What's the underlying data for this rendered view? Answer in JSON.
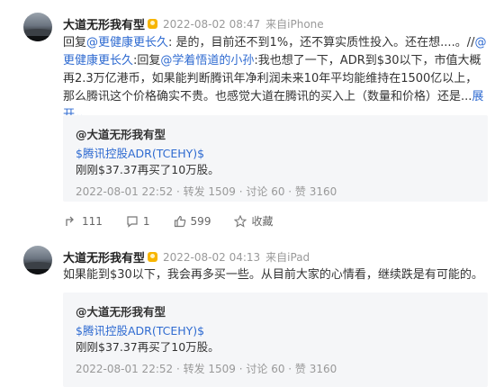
{
  "post1": {
    "author": "大道无形我有型",
    "timestamp": "2022-08-02 08:47",
    "source": "来自iPhone",
    "body": {
      "t1": "回复",
      "m1": "@更健康更长久",
      "t2": ": 是的，目前还不到1%，还不算实质性投入。还在想....。//",
      "m2": "@更健康更长久",
      "t3": ":回复",
      "m3": "@学着悟道的小孙",
      "t4": ":我也想了一下，ADR到$30以下，市值大概再2.3万亿港币，如果能判断腾讯年净利润未来10年平均能维持在1500亿以上，那么腾讯这个价格确实不贵。也感觉大道在腾讯的买入上（数量和价格）还是...",
      "expand": "展开",
      "expand_arrow": "⌄"
    },
    "quote": {
      "author": "@大道无形我有型",
      "stock": "$腾讯控股ADR(TCEHY)$",
      "text": "刚刚$37.37再买了10万股。",
      "meta": "2022-08-01 22:52 · 转发 1509 · 讨论 60 · 赞 3160"
    },
    "actions": {
      "repost_count": "111",
      "comment_count": "1",
      "like_count": "599",
      "favorite_label": "收藏"
    }
  },
  "post2": {
    "author": "大道无形我有型",
    "timestamp": "2022-08-02 04:13",
    "source": "来自iPad",
    "body": "如果能到$30以下，我会再多买一些。从目前大家的心情看，继续跌是有可能的。",
    "quote": {
      "author": "@大道无形我有型",
      "stock": "$腾讯控股ADR(TCEHY)$",
      "text": "刚刚$37.37再买了10万股。",
      "meta": "2022-08-01 22:52 · 转发 1509 · 讨论 60 · 赞 3160"
    }
  },
  "colors": {
    "link": "#2f6bd1",
    "vip_badge": "#f7b500"
  }
}
